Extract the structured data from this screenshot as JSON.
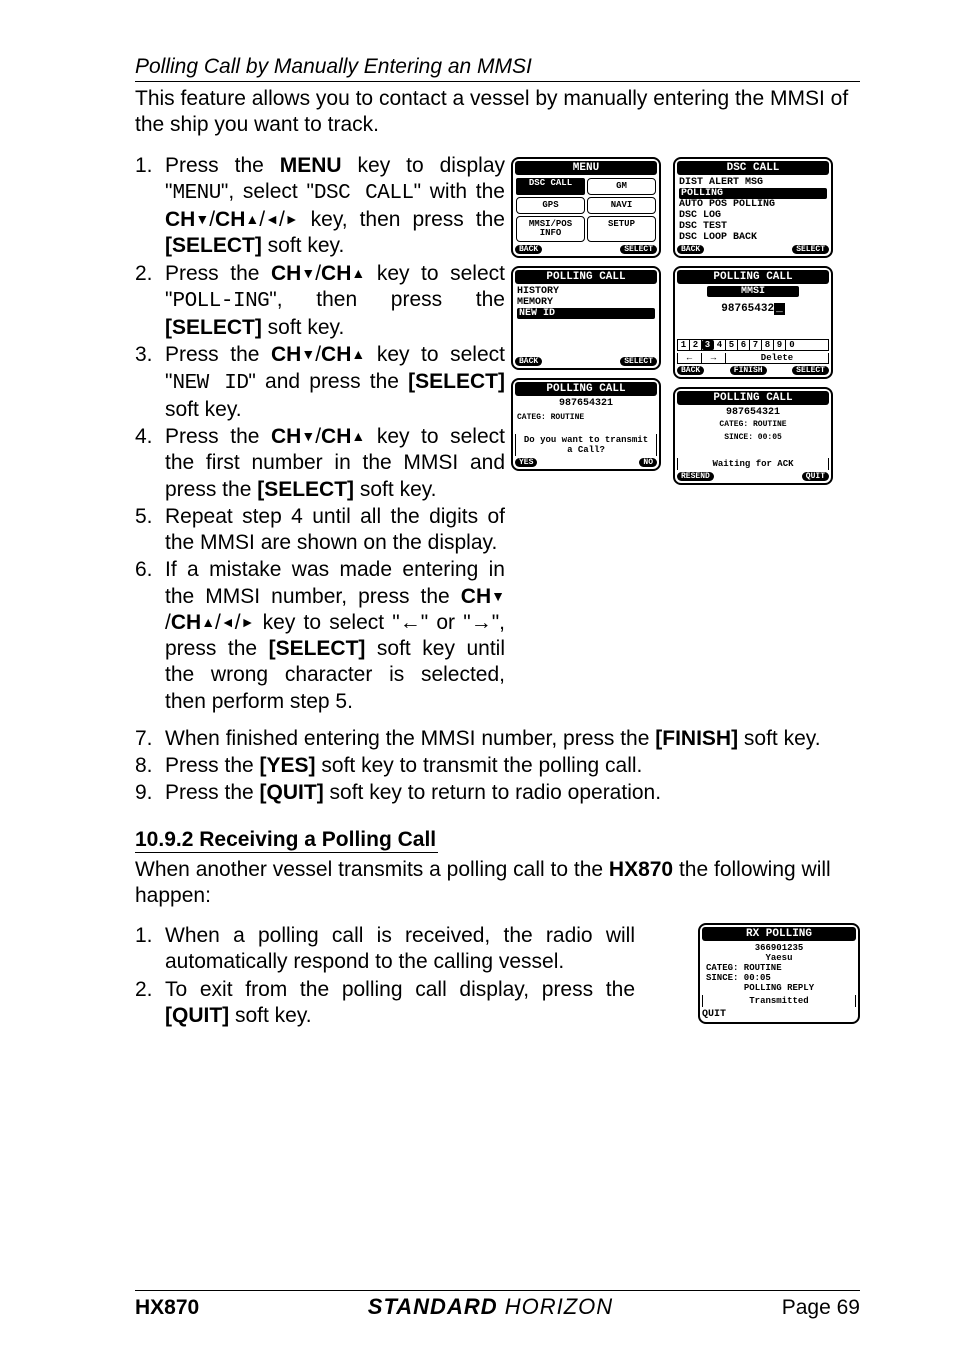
{
  "subheading": "Polling Call by Manually Entering an MMSI",
  "intro": "This feature allows you to contact a vessel by manually entering the MMSI of the ship you want to track.",
  "steps_a": [
    {
      "n": "1.",
      "t": "Press the <b>MENU</b> key to display \"<span class='mono'>MENU</span>\", select \"<span class='mono'>DSC CALL</span>\" with the <b>CH<span class='arrow'>▼</span></b>/<b>CH<span class='arrow'>▲</span></b>/<span class='arrow'>◄</span>/<span class='arrow'>►</span> key, then press the <b>[SELECT]</b> soft key."
    },
    {
      "n": "2.",
      "t": "Press the <b>CH<span class='arrow'>▼</span></b>/<b>CH<span class='arrow'>▲</span></b> key to select \"<span class='mono'>POLL-ING</span>\", then press the <b>[SELECT]</b> soft key."
    },
    {
      "n": "3.",
      "t": "Press the <b>CH<span class='arrow'>▼</span></b>/<b>CH<span class='arrow'>▲</span></b> key to select \"<span class='mono'>NEW ID</span>\" and press the <b>[SELECT]</b> soft key."
    },
    {
      "n": "4.",
      "t": "Press the <b>CH<span class='arrow'>▼</span></b>/<b>CH<span class='arrow'>▲</span></b> key to select the first number in the MMSI and press the <b>[SELECT]</b> soft key."
    },
    {
      "n": "5.",
      "t": "Repeat step 4 until all the digits of the MMSI are shown on the display."
    },
    {
      "n": "6.",
      "t": "If a mistake was made entering in the MMSI number, press the <b>CH<span class='arrow'>▼</span></b>/<b>CH<span class='arrow'>▲</span></b>/<span class='arrow'>◄</span>/<span class='arrow'>►</span> key to select \"←\" or \"→\", press the <b>[SELECT]</b> soft key until the wrong character is selected, then perform step 5."
    }
  ],
  "steps_b": [
    {
      "n": "7.",
      "t": "When finished entering the MMSI number, press the <b>[FINISH]</b> soft key."
    },
    {
      "n": "8.",
      "t": "Press the <b>[YES]</b> soft key to transmit the polling call."
    },
    {
      "n": "9.",
      "t": "Press the <b>[QUIT]</b> soft key to return to radio operation."
    }
  ],
  "sec2": {
    "heading": "10.9.2  Receiving a Polling Call",
    "intro": "When another vessel transmits a polling call to the <b>HX870</b> the following will happen:",
    "steps": [
      {
        "n": "1.",
        "t": "When a polling call is received, the radio will automatically respond to the calling vessel."
      },
      {
        "n": "2.",
        "t": "To exit from the polling call display, press the <b>[QUIT]</b> soft key."
      }
    ]
  },
  "diagrams": {
    "menu": {
      "title": "MENU",
      "cells": [
        "DSC CALL",
        "GM",
        "GPS",
        "NAVI",
        "MMSI/POS INFO",
        "SETUP"
      ],
      "soft": [
        "BACK",
        "SELECT"
      ]
    },
    "dsccall": {
      "title": "DSC CALL",
      "lines": [
        "DIST ALERT MSG",
        "POLLING",
        "AUTO POS POLLING",
        "DSC LOG",
        "DSC TEST",
        "DSC LOOP BACK"
      ],
      "sel": 1,
      "soft": [
        "BACK",
        "SELECT"
      ]
    },
    "pollingcall1": {
      "title": "POLLING CALL",
      "lines": [
        "HISTORY",
        "MEMORY",
        "NEW ID"
      ],
      "sel": 2,
      "soft": [
        "BACK",
        "SELECT"
      ]
    },
    "mmsi": {
      "title": "POLLING CALL",
      "sub": "MMSI",
      "value": "98765432",
      "nums": [
        "1",
        "2",
        "3",
        "4",
        "5",
        "6",
        "7",
        "8",
        "9",
        "0"
      ],
      "numsel": 2,
      "row2": [
        "←",
        "→",
        "Delete"
      ],
      "soft": [
        "BACK",
        "FINISH",
        "SELECT"
      ]
    },
    "confirm": {
      "title": "POLLING CALL",
      "value": "987654321",
      "categ": "CATEG: ROUTINE",
      "prompt": "Do you want to transmit a Call?",
      "soft": [
        "YES",
        "NO"
      ]
    },
    "waiting": {
      "title": "POLLING CALL",
      "value": "987654321",
      "categ": "CATEG: ROUTINE",
      "since": "SINCE: 00:05",
      "status": "Waiting for ACK",
      "soft": [
        "RESEND",
        "QUIT"
      ]
    },
    "rx": {
      "title": "RX POLLING",
      "mmsi": "366901235",
      "name": "Yaesu",
      "categ": "CATEG: ROUTINE",
      "since": "SINCE: 00:05",
      "reply": "POLLING REPLY",
      "status": "Transmitted",
      "soft": "QUIT"
    }
  },
  "footer": {
    "model": "HX870",
    "brand1": "STANDARD",
    "brand2": " HORIZON",
    "page": "Page 69"
  }
}
